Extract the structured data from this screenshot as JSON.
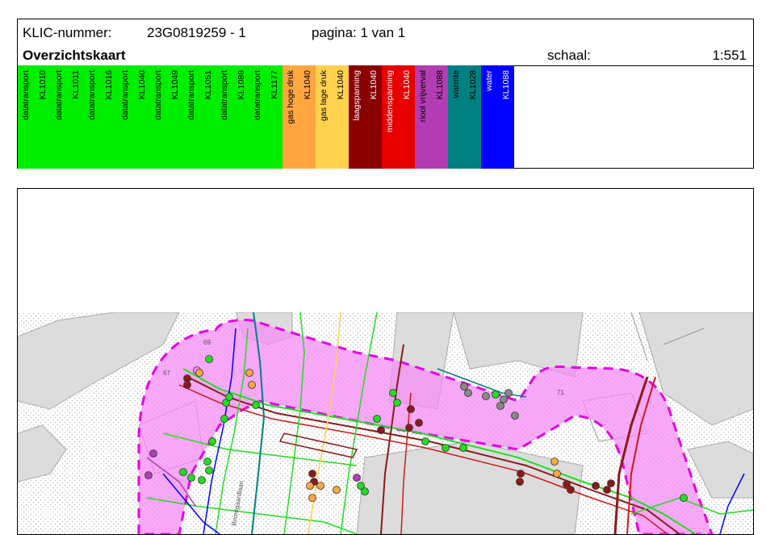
{
  "header": {
    "klic_label": "KLIC-nummer:",
    "klic_number": "23G0819259 - 1",
    "page_info": "pagina: 1 van 1",
    "title": "Overzichtskaart",
    "scale_label": "schaal:",
    "scale_value": "1:551"
  },
  "legend": [
    {
      "type": "datatransport",
      "code": "KL1010",
      "color": "#00ee00",
      "text": "#000000"
    },
    {
      "type": "datatransport",
      "code": "KL1011",
      "color": "#00ee00",
      "text": "#000000"
    },
    {
      "type": "datatransport",
      "code": "KL1016",
      "color": "#00ee00",
      "text": "#000000"
    },
    {
      "type": "datatransport",
      "code": "KL1040",
      "color": "#00ee00",
      "text": "#000000"
    },
    {
      "type": "datatransport",
      "code": "KL1049",
      "color": "#00ee00",
      "text": "#000000"
    },
    {
      "type": "datatransport",
      "code": "KL1051",
      "color": "#00ee00",
      "text": "#000000"
    },
    {
      "type": "datatransport",
      "code": "KL1089",
      "color": "#00ee00",
      "text": "#000000"
    },
    {
      "type": "datatransport",
      "code": "KL1177",
      "color": "#00ee00",
      "text": "#000000"
    },
    {
      "type": "gas hoge druk",
      "code": "KL1040",
      "color": "#ffa641",
      "text": "#000000"
    },
    {
      "type": "gas lage druk",
      "code": "KL1040",
      "color": "#ffd24d",
      "text": "#000000"
    },
    {
      "type": "laagspanning",
      "code": "KL1040",
      "color": "#8b0000",
      "text": "#ffffff"
    },
    {
      "type": "middenspanning",
      "code": "KL1040",
      "color": "#e60000",
      "text": "#ffffff"
    },
    {
      "type": "riool vrijverval",
      "code": "KL1088",
      "color": "#b23cb2",
      "text": "#000000"
    },
    {
      "type": "warmte",
      "code": "KL1028",
      "color": "#008080",
      "text": "#000000"
    },
    {
      "type": "water",
      "code": "KL1088",
      "color": "#0000ff",
      "text": "#ffffff"
    }
  ],
  "map": {
    "street_name": "Boomgaardlaan",
    "building_numbers": [
      "69",
      "67",
      "71"
    ]
  },
  "colors": {
    "zone_fill": "#f58cf5",
    "zone_border": "#e600e6",
    "building": "#dcdcdc",
    "datatransport": "#22dd22",
    "laagspanning": "#8b1a1a",
    "middenspanning": "#cc1a1a"
  }
}
